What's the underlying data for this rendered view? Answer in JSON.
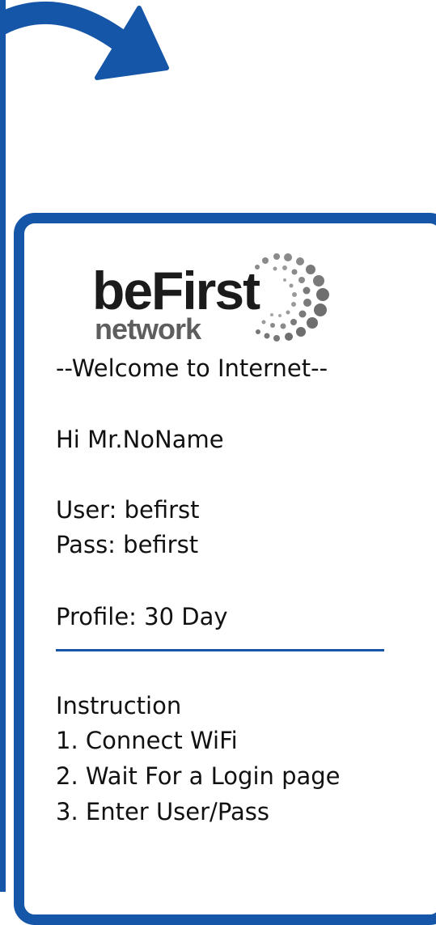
{
  "logo": {
    "word_main": "beFirst",
    "word_sub": "network"
  },
  "voucher": {
    "welcome": "--Welcome to Internet--",
    "greeting": "Hi Mr.NoName",
    "user_line": "User: befirst",
    "pass_line": "Pass: befirst",
    "profile_line": "Profile: 30 Day"
  },
  "instructions": {
    "title": "Instruction",
    "steps": [
      "1. Connect WiFi",
      "2. Wait For a Login page",
      "3. Enter User/Pass"
    ]
  },
  "colors": {
    "accent": "#1656a8",
    "text": "#111111",
    "logo_dark": "#1b1b1b",
    "logo_grey": "#5e5e5e"
  },
  "icons": {
    "arrow": "curved-arrow-icon",
    "logo_mark": "dot-swirl-icon"
  }
}
